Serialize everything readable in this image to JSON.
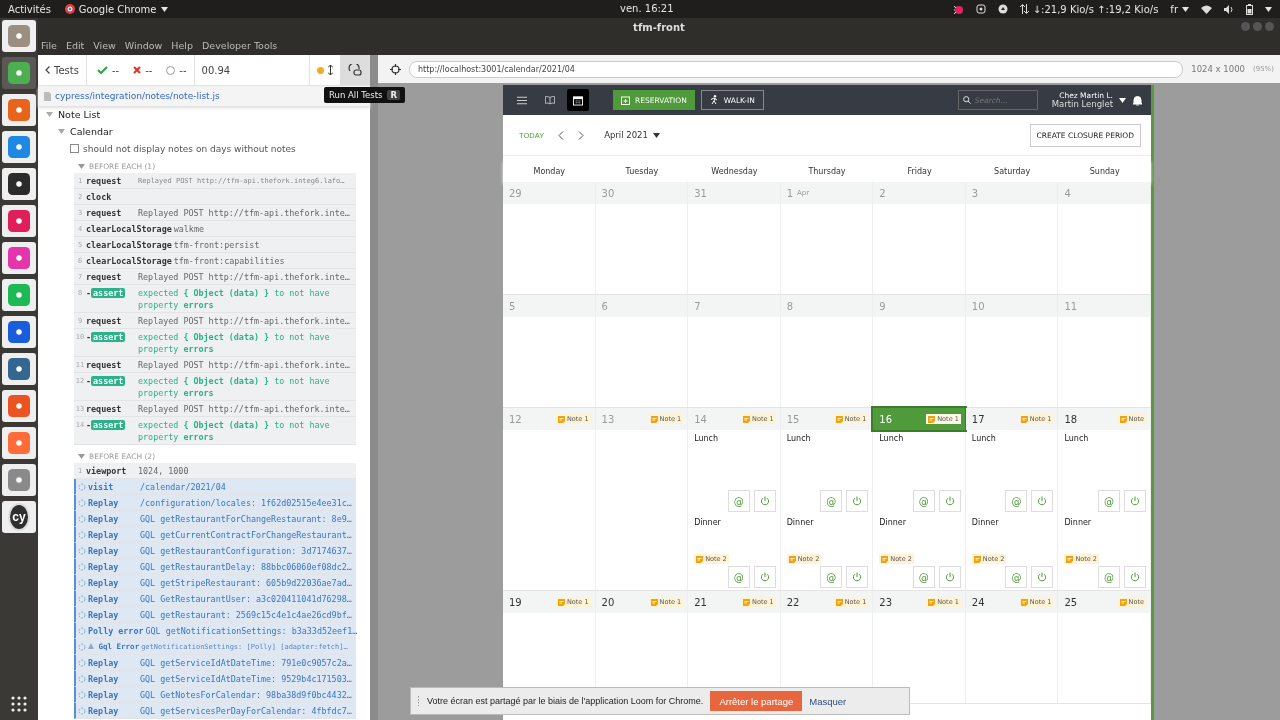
{
  "system_bar": {
    "activities": "Activités",
    "app_menu": "Google Chrome",
    "clock": "ven. 16:21",
    "network": "↓:21,9 Kio/s ↑:19,2 Kio/s",
    "language": "fr"
  },
  "dock": [
    {
      "color": "#9a8f80",
      "selected": false
    },
    {
      "color": "#4caf50",
      "selected": true
    },
    {
      "color": "#e8641b",
      "selected": false
    },
    {
      "color": "#1e88e5",
      "selected": false
    },
    {
      "color": "#2b2b2b",
      "selected": false
    },
    {
      "color": "#e01e5a",
      "selected": false
    },
    {
      "color": "#e535ab",
      "selected": false
    },
    {
      "color": "#1db954",
      "selected": false
    },
    {
      "color": "#175ddc",
      "selected": false
    },
    {
      "color": "#336791",
      "selected": false
    },
    {
      "color": "#e95420",
      "selected": false
    },
    {
      "color": "#ff6c37",
      "selected": false
    },
    {
      "color": "#8a8a8a",
      "selected": false
    },
    {
      "color": "#2f2f2f",
      "selected": false,
      "label": "cy"
    }
  ],
  "window": {
    "title": "tfm-front",
    "menu": [
      "File",
      "Edit",
      "View",
      "Window",
      "Help",
      "Developer Tools"
    ]
  },
  "runner": {
    "tests_link": "Tests",
    "passed": "--",
    "failed": "--",
    "pending": "--",
    "duration": "00.94",
    "tooltip": "Run All Tests",
    "tooltip_key": "R",
    "spec_path": "cypress/integration/notes/note-list.js",
    "tree": [
      {
        "title": "Note List",
        "expanded": true,
        "children": [
          {
            "title": "Calendar",
            "expanded": true,
            "children": [
              {
                "title": "should not display notes on days without notes",
                "checked": false
              }
            ]
          }
        ]
      }
    ],
    "hooks": [
      {
        "title": "BEFORE EACH (1)",
        "expanded": true,
        "commands": [
          {
            "number": "1",
            "name": "request",
            "message": "Replayed POST http://tfm-api.thefork.integ6.lafo…",
            "kind": "small"
          },
          {
            "number": "2",
            "name": "clock",
            "kind": "done"
          },
          {
            "number": "3",
            "name": "request",
            "message": "Replayed POST http://tfm-api.thefork.inte…",
            "kind": "done"
          },
          {
            "number": "4",
            "name": "clearLocalStorage",
            "message": "walkme",
            "kind": "done"
          },
          {
            "number": "5",
            "name": "clearLocalStorage",
            "message": "tfm-front:persist",
            "kind": "done"
          },
          {
            "number": "6",
            "name": "clearLocalStorage",
            "message": "tfm-front:capabilities",
            "kind": "done"
          },
          {
            "number": "7",
            "name": "request",
            "message": "Replayed POST http://tfm-api.thefork.inte…",
            "kind": "done"
          },
          {
            "number": "8",
            "prefix": "-",
            "name": "assert",
            "message": "expected **{ Object (data) }** to not have property **errors**",
            "kind": "assert"
          },
          {
            "number": "9",
            "name": "request",
            "message": "Replayed POST http://tfm-api.thefork.inte…",
            "kind": "done"
          },
          {
            "number": "10",
            "prefix": "-",
            "name": "assert",
            "message": "expected **{ Object (data) }** to not have property **errors**",
            "kind": "assert"
          },
          {
            "number": "11",
            "name": "request",
            "message": "Replayed POST http://tfm-api.thefork.inte…",
            "kind": "done"
          },
          {
            "number": "12",
            "prefix": "-",
            "name": "assert",
            "message": "expected **{ Object (data) }** to not have property **errors**",
            "kind": "assert"
          },
          {
            "number": "13",
            "name": "request",
            "message": "Replayed POST http://tfm-api.thefork.inte…",
            "kind": "done"
          },
          {
            "number": "14",
            "prefix": "-",
            "name": "assert",
            "message": "expected **{ Object (data) }** to not have property **errors**",
            "kind": "assert"
          }
        ]
      },
      {
        "title": "BEFORE EACH (2)",
        "expanded": true,
        "commands": [
          {
            "number": "1",
            "name": "viewport",
            "message": "1024, 1000",
            "kind": "done"
          },
          {
            "name": "visit",
            "message": "/calendar/2021/04",
            "kind": "pending"
          },
          {
            "name": "Replay",
            "message": "/configuration/locales: 1f62d02515e4ee31c…",
            "kind": "pending"
          },
          {
            "name": "Replay",
            "message": "GQL getRestaurantForChangeRestaurant: 8e9…",
            "kind": "pending"
          },
          {
            "name": "Replay",
            "message": "GQL getCurrentContractForChangeRestaurant…",
            "kind": "pending"
          },
          {
            "name": "Replay",
            "message": "GQL getRestaurantConfiguration: 3d7174637…",
            "kind": "pending"
          },
          {
            "name": "Replay",
            "message": "GQL getRestaurantDelay: 88bbc06060ef08dc2…",
            "kind": "pending"
          },
          {
            "name": "Replay",
            "message": "GQL getStripeRestaurant: 605b9d22036ae7ad…",
            "kind": "pending"
          },
          {
            "name": "Replay",
            "message": "GQL GetRestaurantUser: a3c020411041d76298…",
            "kind": "pending"
          },
          {
            "name": "Replay",
            "message": "GQL getRestaurant: 2569c15c4e1c4ae26cd9bf…",
            "kind": "pending"
          },
          {
            "name": "Polly error",
            "message": "GQL getNotificationSettings: b3a33d52eef1…",
            "kind": "pending"
          },
          {
            "name": "Gql Error",
            "message": "getNotificationSettings: [Polly] [adapter:fetch]…",
            "kind": "error"
          },
          {
            "name": "Replay",
            "message": "GQL getServiceIdAtDateTime: 791e0c9057c2a…",
            "kind": "pending"
          },
          {
            "name": "Replay",
            "message": "GQL getServiceIdAtDateTime: 9529b4c171503…",
            "kind": "pending"
          },
          {
            "name": "Replay",
            "message": "GQL GetNotesForCalendar: 98ba38d9f0bc4432…",
            "kind": "pending"
          },
          {
            "name": "Replay",
            "message": "GQL getServicesPerDayForCalendar: 4fbfdc7…",
            "kind": "pending"
          }
        ]
      }
    ]
  },
  "preview": {
    "url": "http://localhost:3001/calendar/2021/04",
    "size": "1024 x 1000",
    "scale": "(95%)"
  },
  "app": {
    "views": [
      {
        "kind": "menu",
        "selected": false
      },
      {
        "kind": "book",
        "selected": false
      },
      {
        "kind": "calendar",
        "selected": true
      }
    ],
    "reservation": "RESERVATION",
    "walk_in": "WALK-IN",
    "search_placeholder": "Search...",
    "restaurant": "Chez Martin L.",
    "user": "Martin Lenglet",
    "today": "TODAY",
    "month": "April 2021",
    "closure": "CREATE CLOSURE PERIOD",
    "weekdays": [
      "Monday",
      "Tuesday",
      "Wednesday",
      "Thursday",
      "Friday",
      "Saturday",
      "Sunday"
    ],
    "weeks": [
      [
        {
          "day": "29",
          "past": true,
          "selected": false
        },
        {
          "day": "30",
          "past": true,
          "selected": false
        },
        {
          "day": "31",
          "past": true,
          "selected": false
        },
        {
          "day": "1",
          "month": "Apr",
          "past": true,
          "selected": false
        },
        {
          "day": "2",
          "past": true,
          "selected": false
        },
        {
          "day": "3",
          "past": true,
          "selected": false
        },
        {
          "day": "4",
          "past": true,
          "selected": false
        }
      ],
      [
        {
          "day": "5",
          "past": true,
          "selected": false
        },
        {
          "day": "6",
          "past": true,
          "selected": false
        },
        {
          "day": "7",
          "past": true,
          "selected": false
        },
        {
          "day": "8",
          "past": true,
          "selected": false
        },
        {
          "day": "9",
          "past": true,
          "selected": false
        },
        {
          "day": "10",
          "past": true,
          "selected": false
        },
        {
          "day": "11",
          "past": true,
          "selected": false
        }
      ],
      [
        {
          "day": "12",
          "past": true,
          "selected": false,
          "note": "Note 1"
        },
        {
          "day": "13",
          "past": true,
          "selected": false,
          "note": "Note 1"
        },
        {
          "day": "14",
          "past": true,
          "selected": false,
          "note": "Note 1",
          "services": [
            {
              "name": "Lunch",
              "at": "@"
            },
            {
              "name": "Dinner",
              "note": "Note 2",
              "at": "@"
            }
          ]
        },
        {
          "day": "15",
          "past": true,
          "selected": false,
          "note": "Note 1",
          "services": [
            {
              "name": "Lunch",
              "at": "@"
            },
            {
              "name": "Dinner",
              "note": "Note 2",
              "at": "@"
            }
          ]
        },
        {
          "day": "16",
          "past": false,
          "selected": true,
          "note": "Note 1",
          "services": [
            {
              "name": "Lunch",
              "at": "@"
            },
            {
              "name": "Dinner",
              "note": "Note 2",
              "at": "@"
            }
          ]
        },
        {
          "day": "17",
          "past": false,
          "selected": false,
          "note": "Note 1",
          "services": [
            {
              "name": "Lunch",
              "at": "@"
            },
            {
              "name": "Dinner",
              "note": "Note 2",
              "at": "@"
            }
          ]
        },
        {
          "day": "18",
          "past": false,
          "selected": false,
          "note": "Note",
          "services": [
            {
              "name": "Lunch",
              "at": "@"
            },
            {
              "name": "Dinner",
              "note": "Note 2",
              "at": "@"
            }
          ]
        }
      ],
      [
        {
          "day": "19",
          "past": false,
          "selected": false,
          "note": "Note 1"
        },
        {
          "day": "20",
          "past": false,
          "selected": false,
          "note": "Note 1"
        },
        {
          "day": "21",
          "past": false,
          "selected": false,
          "note": "Note 1"
        },
        {
          "day": "22",
          "past": false,
          "selected": false,
          "note": "Note 1"
        },
        {
          "day": "23",
          "past": false,
          "selected": false,
          "note": "Note 1"
        },
        {
          "day": "24",
          "past": false,
          "selected": false,
          "note": "Note 1"
        },
        {
          "day": "25",
          "past": false,
          "selected": false,
          "note": "Note"
        }
      ]
    ]
  },
  "loom": {
    "message": "Votre écran est partagé par le biais de l'application Loom for Chrome.",
    "stop": "Arrêter le partage",
    "hide": "Masquer"
  }
}
